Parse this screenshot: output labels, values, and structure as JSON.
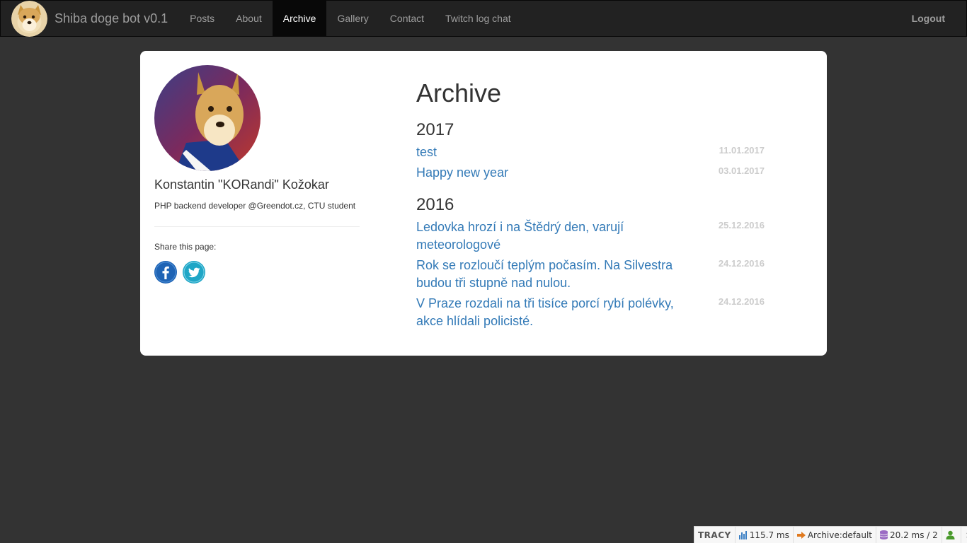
{
  "navbar": {
    "brand": "Shiba doge bot v0.1",
    "links": [
      "Posts",
      "About",
      "Archive",
      "Gallery",
      "Contact",
      "Twitch log chat"
    ],
    "active": "Archive",
    "logout": "Logout"
  },
  "profile": {
    "name": "Konstantin \"KORandi\" Kožokar",
    "description": "PHP backend developer @Greendot.cz, CTU student",
    "share_label": "Share this page:"
  },
  "archive": {
    "title": "Archive",
    "groups": [
      {
        "year": "2017",
        "posts": [
          {
            "title": "test",
            "date": "11.01.2017"
          },
          {
            "title": "Happy new year",
            "date": "03.01.2017"
          }
        ]
      },
      {
        "year": "2016",
        "posts": [
          {
            "title": "Ledovka hrozí i na Štědrý den, varují meteorologové",
            "date": "25.12.2016"
          },
          {
            "title": "Rok se rozloučí teplým počasím. Na Silvestra budou tři stupně nad nulou.",
            "date": "24.12.2016"
          },
          {
            "title": "V Praze rozdali na tři tisíce porcí rybí polévky, akce hlídali policisté.",
            "date": "24.12.2016"
          }
        ]
      }
    ]
  },
  "tracy": {
    "logo": "TRACY",
    "time": "115.7 ms",
    "presenter": "Archive:default",
    "db": "20.2 ms / 2",
    "close": "×"
  },
  "colors": {
    "link": "#337ab7",
    "navbar_bg": "#222222",
    "page_bg": "#333333",
    "date": "#cccccc"
  }
}
